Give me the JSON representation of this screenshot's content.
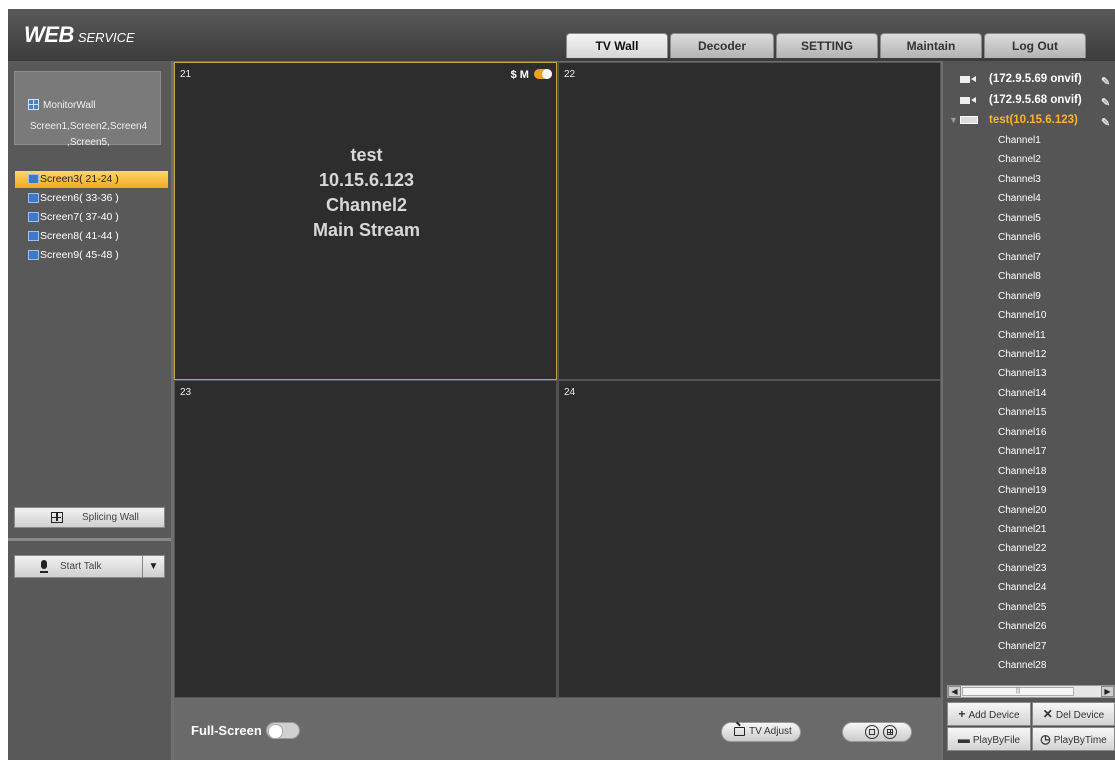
{
  "header": {
    "logo_main": "WEB",
    "logo_sub": "SERVICE",
    "tabs": [
      "TV Wall",
      "Decoder",
      "SETTING",
      "Maintain",
      "Log Out"
    ],
    "active_tab": "TV Wall"
  },
  "left_panel": {
    "monitor_wall_label": "MonitorWall",
    "monitor_wall_screens_line1": "Screen1,Screen2,Screen4",
    "monitor_wall_screens_line2": ",Screen5,",
    "screens": [
      {
        "label": "Screen3( 21-24 )",
        "selected": true
      },
      {
        "label": "Screen6( 33-36 )",
        "selected": false
      },
      {
        "label": "Screen7( 37-40 )",
        "selected": false
      },
      {
        "label": "Screen8( 41-44 )",
        "selected": false
      },
      {
        "label": "Screen9( 45-48 )",
        "selected": false
      }
    ],
    "splicing_wall_label": "Splicing Wall",
    "start_talk_label": "Start Talk"
  },
  "video": {
    "cells": [
      {
        "num": "21",
        "active": true
      },
      {
        "num": "22",
        "active": false
      },
      {
        "num": "23",
        "active": false
      },
      {
        "num": "24",
        "active": false
      }
    ],
    "active_info": {
      "device": "test",
      "ip": "10.15.6.123",
      "channel": "Channel2",
      "stream": "Main Stream"
    },
    "cell_mode_label": "M",
    "cell_icon": "$"
  },
  "bottom_bar": {
    "fullscreen_label": "Full-Screen",
    "tv_adjust_label": "TV Adjust"
  },
  "right_panel": {
    "devices": [
      {
        "label": "(172.9.5.69 onvif)",
        "type": "camera",
        "expanded": false
      },
      {
        "label": "(172.9.5.68 onvif)",
        "type": "camera",
        "expanded": false
      },
      {
        "label": "test(10.15.6.123)",
        "type": "nvr",
        "expanded": true
      }
    ],
    "channels": [
      "Channel1",
      "Channel2",
      "Channel3",
      "Channel4",
      "Channel5",
      "Channel6",
      "Channel7",
      "Channel8",
      "Channel9",
      "Channel10",
      "Channel11",
      "Channel12",
      "Channel13",
      "Channel14",
      "Channel15",
      "Channel16",
      "Channel17",
      "Channel18",
      "Channel19",
      "Channel20",
      "Channel21",
      "Channel22",
      "Channel23",
      "Channel24",
      "Channel25",
      "Channel26",
      "Channel27",
      "Channel28"
    ],
    "add_device_label": "Add Device",
    "del_device_label": "Del Device",
    "play_by_file_label": "PlayByFile",
    "play_by_time_label": "PlayByTime"
  },
  "colors": {
    "selected_screen": "#f2a824",
    "expanded_device": "#ffb32b",
    "active_cell_border": "#c9a34a",
    "panel_bg": "#595959"
  }
}
